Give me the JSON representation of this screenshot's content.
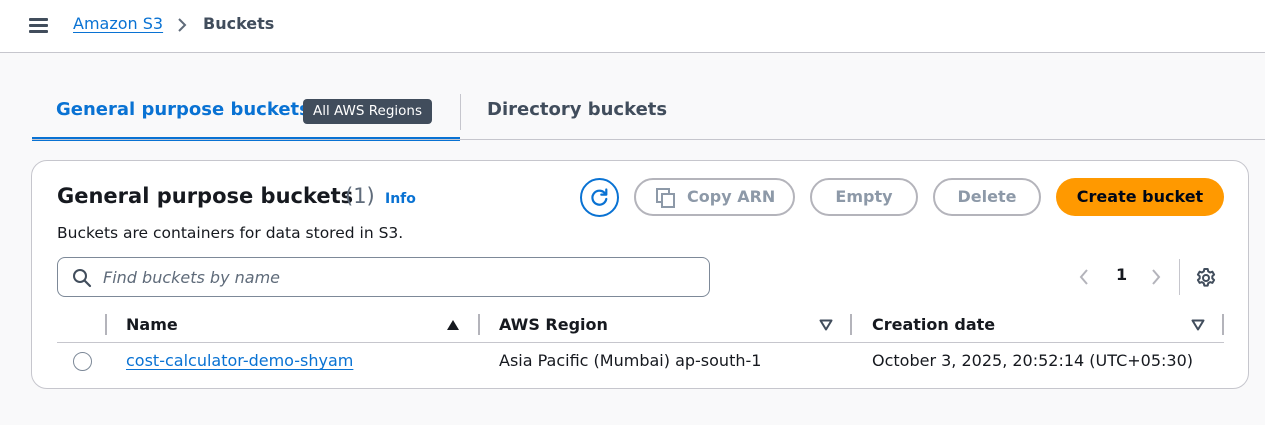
{
  "breadcrumb": {
    "root": "Amazon S3",
    "current": "Buckets"
  },
  "tabs": [
    {
      "label": "General purpose buckets",
      "badge": "All AWS Regions",
      "active": true
    },
    {
      "label": "Directory buckets",
      "active": false
    }
  ],
  "panel": {
    "title": "General purpose buckets",
    "count": "(1)",
    "info": "Info",
    "description": "Buckets are containers for data stored in S3.",
    "buttons": {
      "copy_arn": "Copy ARN",
      "empty": "Empty",
      "delete": "Delete",
      "create": "Create bucket"
    },
    "search": {
      "placeholder": "Find buckets by name",
      "value": ""
    },
    "pagination": {
      "current_page": "1"
    }
  },
  "table": {
    "columns": [
      "Name",
      "AWS Region",
      "Creation date"
    ],
    "rows": [
      {
        "name": "cost-calculator-demo-shyam",
        "region": "Asia Pacific (Mumbai) ap-south-1",
        "created": "October 3, 2025, 20:52:14 (UTC+05:30)"
      }
    ]
  },
  "colors": {
    "link": "#0972d3",
    "primary_button": "#ff9900",
    "badge_bg": "#414d5c",
    "disabled": "#8d99a8"
  },
  "icons": [
    "menu-icon",
    "chevron-right-icon",
    "refresh-icon",
    "copy-icon",
    "search-icon",
    "chevron-left-icon",
    "settings-icon",
    "sort-ascending-icon",
    "sort-descending-icon"
  ]
}
